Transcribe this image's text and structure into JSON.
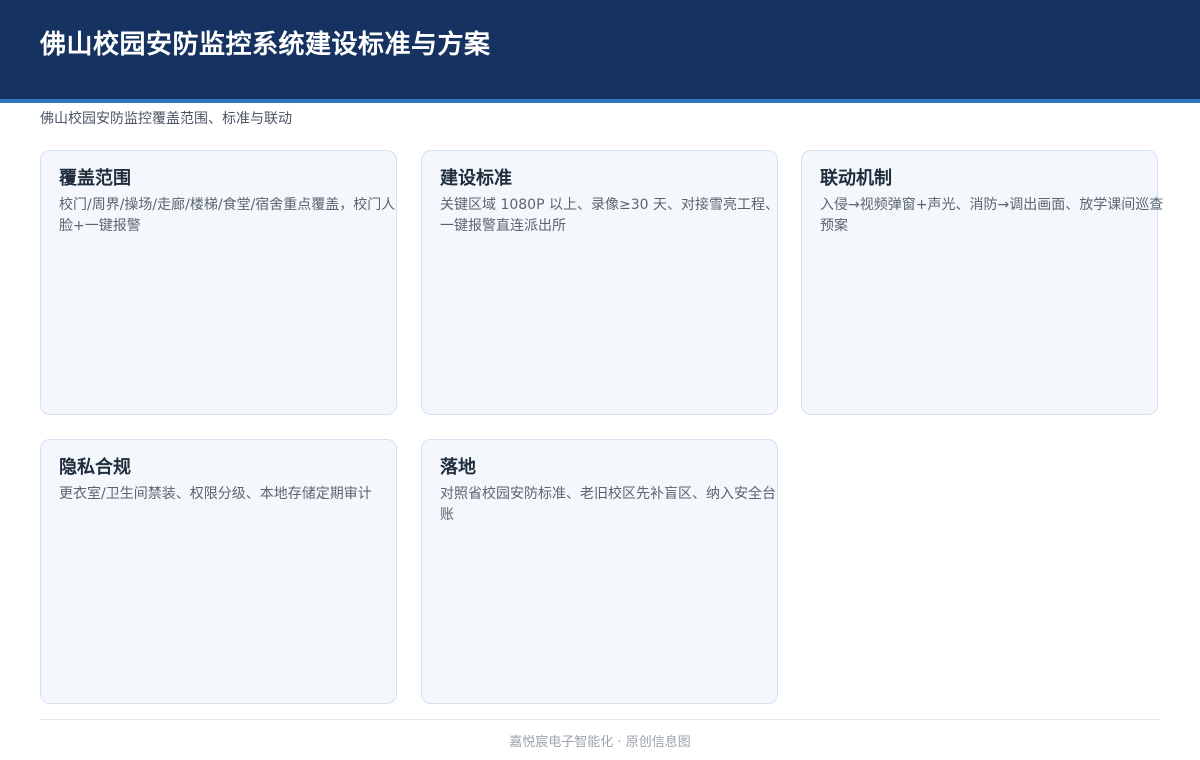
{
  "header": {
    "title": "佛山校园安防监控系统建设标准与方案"
  },
  "subtitle": "佛山校园安防监控覆盖范围、标准与联动",
  "cards": [
    {
      "title": "覆盖范围",
      "body": "校门/周界/操场/走廊/楼梯/食堂/宿舍重点覆盖，校门人脸+一键报警"
    },
    {
      "title": "建设标准",
      "body": "关键区域 1080P 以上、录像≥30 天、对接雪亮工程、一键报警直连派出所"
    },
    {
      "title": "联动机制",
      "body": "入侵→视频弹窗+声光、消防→调出画面、放学课间巡查预案"
    },
    {
      "title": "隐私合规",
      "body": "更衣室/卫生间禁装、权限分级、本地存储定期审计"
    },
    {
      "title": "落地",
      "body": "对照省校园安防标准、老旧校区先补盲区、纳入安全台账"
    }
  ],
  "footer": {
    "text": "嘉悦宸电子智能化 · 原创信息图"
  }
}
